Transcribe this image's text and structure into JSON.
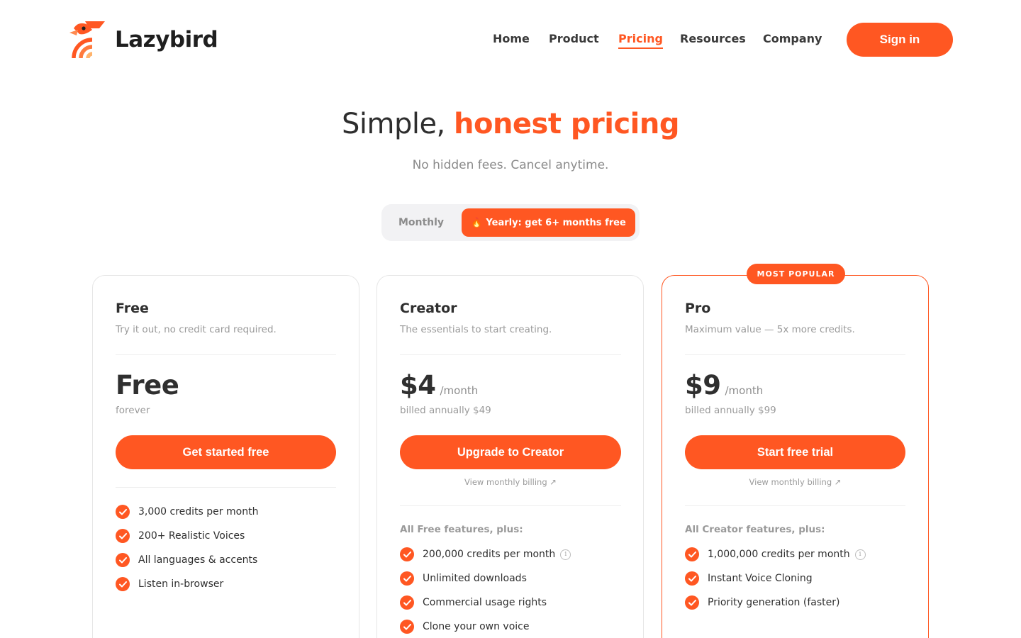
{
  "brand": {
    "name": "Lazybird"
  },
  "nav": {
    "items": [
      {
        "label": "Home"
      },
      {
        "label": "Product"
      },
      {
        "label": "Pricing"
      },
      {
        "label": "Resources"
      },
      {
        "label": "Company"
      }
    ],
    "active": "Pricing",
    "signin_label": "Sign in"
  },
  "hero": {
    "title_plain": "Simple,",
    "title_accent": "honest pricing",
    "subtitle": "No hidden fees. Cancel anytime."
  },
  "billing_toggle": {
    "monthly_label": "Monthly",
    "yearly_label": "Yearly: get 6+ months free",
    "selected": "yearly"
  },
  "plans": [
    {
      "name": "Free",
      "description": "Try it out, no credit card required.",
      "price": "Free",
      "price_note": "forever",
      "cta_label": "Get started free",
      "features": [
        {
          "text": "3,000 credits per month"
        },
        {
          "text": "200+ Realistic Voices"
        },
        {
          "text": "All languages & accents"
        },
        {
          "text": "Listen in-browser"
        }
      ]
    },
    {
      "name": "Creator",
      "description": "The essentials to start creating.",
      "price": "$4",
      "period": "/month",
      "price_note": "billed annually $49",
      "cta_label": "Upgrade to Creator",
      "monthly_link": "View monthly billing ↗",
      "features_heading": "All Free features, plus:",
      "features": [
        {
          "text": "200,000 credits per month",
          "info": true
        },
        {
          "text": "Unlimited downloads"
        },
        {
          "text": "Commercial usage rights"
        },
        {
          "text": "Clone your own voice"
        }
      ]
    },
    {
      "name": "Pro",
      "badge": "MOST POPULAR",
      "description": "Maximum value — 5x more credits.",
      "price": "$9",
      "period": "/month",
      "price_note": "billed annually $99",
      "cta_label": "Start free trial",
      "monthly_link": "View monthly billing ↗",
      "features_heading": "All Creator features, plus:",
      "features": [
        {
          "text": "1,000,000 credits per month",
          "info": true
        },
        {
          "text": "Instant Voice Cloning"
        },
        {
          "text": "Priority generation (faster)"
        }
      ]
    }
  ],
  "colors": {
    "accent": "#ff5722",
    "text": "#2f2f2f",
    "muted": "#9a9a9a",
    "border": "#e6e6e6"
  }
}
